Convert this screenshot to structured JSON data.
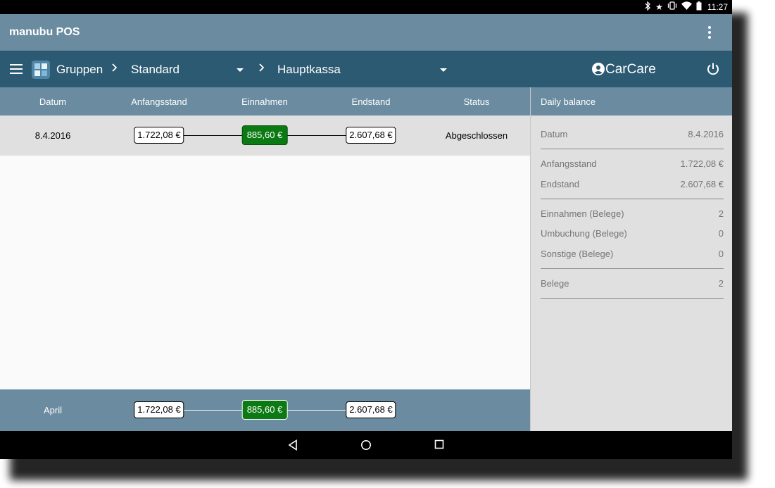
{
  "status_bar": {
    "time": "11:27",
    "icons": [
      "bluetooth-icon",
      "star-icon",
      "vibrate-icon",
      "wifi-icon",
      "battery-icon"
    ]
  },
  "app_bar": {
    "title": "manubu POS",
    "overflow_icon": "more-vert-icon"
  },
  "nav_bar": {
    "menu_icon": "menu-icon",
    "groups_label": "Gruppen",
    "group_value": "Standard",
    "register_value": "Hauptkassa",
    "company": "CarCare",
    "power_icon": "power-icon"
  },
  "table": {
    "headers": {
      "datum": "Datum",
      "anfangsstand": "Anfangsstand",
      "einnahmen": "Einnahmen",
      "endstand": "Endstand",
      "status": "Status"
    },
    "rows": [
      {
        "datum": "8.4.2016",
        "anfangsstand": "1.722,08 €",
        "einnahmen": "885,60 €",
        "endstand": "2.607,68 €",
        "status": "Abgeschlossen"
      }
    ],
    "footer": {
      "month": "April",
      "anfangsstand": "1.722,08 €",
      "einnahmen": "885,60 €",
      "endstand": "2.607,68 €"
    }
  },
  "daily_balance": {
    "title": "Daily balance",
    "items": [
      {
        "label": "Datum",
        "value": "8.4.2016"
      },
      {
        "label": "Anfangsstand",
        "value": "1.722,08 €"
      },
      {
        "label": "Endstand",
        "value": "2.607,68 €"
      },
      {
        "label": "Einnahmen (Belege)",
        "value": "2"
      },
      {
        "label": "Umbuchung (Belege)",
        "value": "0"
      },
      {
        "label": "Sonstige (Belege)",
        "value": "0"
      },
      {
        "label": "Belege",
        "value": "2"
      }
    ]
  },
  "system_nav": {
    "icons": [
      "back-icon",
      "home-icon",
      "recents-icon"
    ]
  },
  "colors": {
    "app_bar": "#6a8ba0",
    "nav_bar": "#2c5a72",
    "income_badge": "#0b7a12",
    "row_bg": "#e0e0e0"
  }
}
